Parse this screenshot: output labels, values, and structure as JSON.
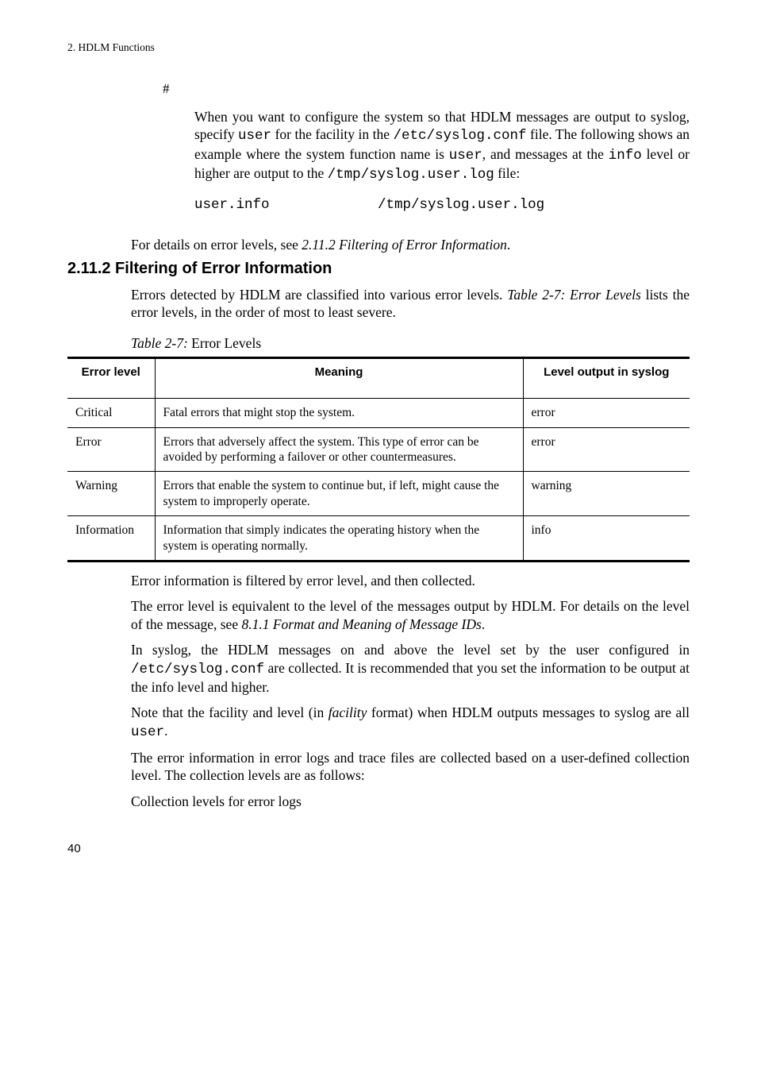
{
  "header": "2. HDLM Functions",
  "hash": "#",
  "block1_parts": [
    "When you want to configure the system so that HDLM messages are output to syslog, specify ",
    "user",
    " for the facility in the ",
    "/etc/syslog.conf",
    " file. The following shows an example where the system function name is ",
    "user",
    ", and messages at the ",
    "info",
    " level or higher are output to the ",
    "/tmp/syslog.user.log",
    " file:"
  ],
  "codeblock": "user.info             /tmp/syslog.user.log",
  "details_line": {
    "pre": "For details on error levels, see ",
    "ital": "2.11.2  Filtering of Error Information",
    "post": "."
  },
  "section_heading": "2.11.2  Filtering of Error Information",
  "sec_para": {
    "pre": "Errors detected by HDLM are classified into various error levels. ",
    "ital": "Table  2-7:  Error Levels",
    "post": " lists the error levels, in the order of most to least severe."
  },
  "table_caption": {
    "ital": "Table  2-7:",
    "rest": "  Error Levels"
  },
  "table": {
    "headers": [
      "Error level",
      "Meaning",
      "Level output in syslog"
    ],
    "rows": [
      {
        "level": "Critical",
        "meaning": "Fatal errors that might stop the system.",
        "syslog": "error"
      },
      {
        "level": "Error",
        "meaning": "Errors that adversely affect the system. This type of error can be avoided by performing a failover or other countermeasures.",
        "syslog": "error"
      },
      {
        "level": "Warning",
        "meaning": "Errors that enable the system to continue but, if left, might cause the system to improperly operate.",
        "syslog": "warning"
      },
      {
        "level": "Information",
        "meaning": "Information that simply indicates the operating history when the system is operating normally.",
        "syslog": "info"
      }
    ]
  },
  "post_paras": {
    "p1": "Error information is filtered by error level, and then collected.",
    "p2": {
      "pre": "The error level is equivalent to the level of the messages output by HDLM. For details on the level of the message, see ",
      "ital": "8.1.1  Format and Meaning of Message IDs",
      "post": "."
    },
    "p3_parts": [
      "In syslog, the HDLM messages on and above the level set by the user configured in ",
      "/etc/syslog.conf",
      " are collected. It is recommended that you set the information to be output at the info level and higher."
    ],
    "p4": {
      "pre": "Note that the facility and level (in ",
      "ital": "facility",
      "post": " format) when HDLM outputs messages to syslog are all ",
      "mono": "user",
      "tail": "."
    },
    "p5": "The error information in error logs and trace files are collected based on a user-defined collection level. The collection levels are as follows:",
    "p6": "Collection levels for error logs"
  },
  "page_no": "40"
}
